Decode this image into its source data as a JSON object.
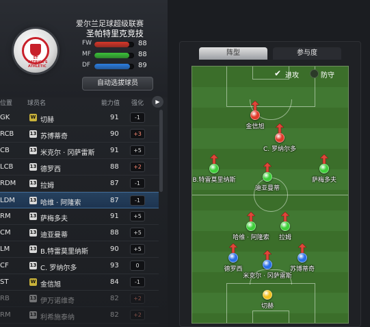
{
  "club": {
    "league": "爱尔兰足球超级联赛",
    "name": "圣帕特里克竞技",
    "crest_text": "ST PATRICK'S ATHLETIC"
  },
  "stats": [
    {
      "label": "FW",
      "value": "88",
      "level": 0.88,
      "color": "#d6382b"
    },
    {
      "label": "MF",
      "value": "88",
      "level": 0.88,
      "color": "#3cc03a"
    },
    {
      "label": "DF",
      "value": "89",
      "level": 0.89,
      "color": "#2d7ee0"
    }
  ],
  "auto_select_label": "自动选拔球员",
  "columns": {
    "position": "位置",
    "name": "球员名",
    "rating": "能力值",
    "boost": "强化"
  },
  "players": [
    {
      "pos": "GK",
      "badge": "W",
      "badge_gold": true,
      "name": "切赫",
      "rating": "91",
      "boost": "-1"
    },
    {
      "pos": "RCB",
      "badge": "13",
      "name": "苏博蒂奇",
      "rating": "90",
      "boost": "+3"
    },
    {
      "pos": "CB",
      "badge": "13",
      "name": "米克尔 · 冈萨雷斯",
      "rating": "91",
      "boost": "+5"
    },
    {
      "pos": "LCB",
      "badge": "13",
      "name": "德罗西",
      "rating": "88",
      "boost": "+2"
    },
    {
      "pos": "RDM",
      "badge": "13",
      "name": "拉姆",
      "rating": "87",
      "boost": "-1"
    },
    {
      "pos": "LDM",
      "badge": "13",
      "name": "哈维 · 阿隆索",
      "rating": "87",
      "boost": "-1",
      "selected": true
    },
    {
      "pos": "RM",
      "badge": "13",
      "name": "萨梅多夫",
      "rating": "91",
      "boost": "+5"
    },
    {
      "pos": "CM",
      "badge": "13",
      "name": "迪亚曼蒂",
      "rating": "88",
      "boost": "+5"
    },
    {
      "pos": "LM",
      "badge": "13",
      "name": "B.特雷莫里纳斯",
      "rating": "90",
      "boost": "+5"
    },
    {
      "pos": "CF",
      "badge": "13",
      "name": "C. 罗纳尔多",
      "rating": "93",
      "boost": "0"
    },
    {
      "pos": "ST",
      "badge": "W",
      "badge_gold": true,
      "name": "金信旭",
      "rating": "84",
      "boost": "-1"
    },
    {
      "pos": "RB",
      "badge": "13",
      "name": "伊万诺维奇",
      "rating": "82",
      "boost": "+2",
      "dim": true
    },
    {
      "pos": "RM",
      "badge": "13",
      "name": "利希施泰纳",
      "rating": "82",
      "boost": "+2",
      "dim": true
    }
  ],
  "tabs": {
    "formation": "阵型",
    "participation": "参与度"
  },
  "toggles": {
    "attack": "进攻",
    "defend": "防守"
  },
  "pitch_players": [
    {
      "name": "金信旭",
      "color": "#e03a2a",
      "arrow": true
    },
    {
      "name": "C. 罗纳尔多",
      "color": "#e03a2a",
      "arrow": true
    },
    {
      "name": "B.特雷莫里纳斯",
      "color": "#3fcf3a",
      "arrow": true
    },
    {
      "name": "迪亚曼蒂",
      "color": "#3fcf3a",
      "arrow": true
    },
    {
      "name": "萨梅多夫",
      "color": "#3fcf3a",
      "arrow": true
    },
    {
      "name": "哈维 · 阿隆索",
      "color": "#3fcf3a",
      "arrow": true
    },
    {
      "name": "拉姆",
      "color": "#3fcf3a",
      "arrow": true
    },
    {
      "name": "德罗西",
      "color": "#2a6fe6",
      "arrow": true
    },
    {
      "name": "米克尔 · 冈萨雷斯",
      "color": "#2a6fe6",
      "arrow": true
    },
    {
      "name": "苏博蒂奇",
      "color": "#2a6fe6",
      "arrow": true
    },
    {
      "name": "切赫",
      "color": "#f0c020",
      "arrow": false
    }
  ]
}
